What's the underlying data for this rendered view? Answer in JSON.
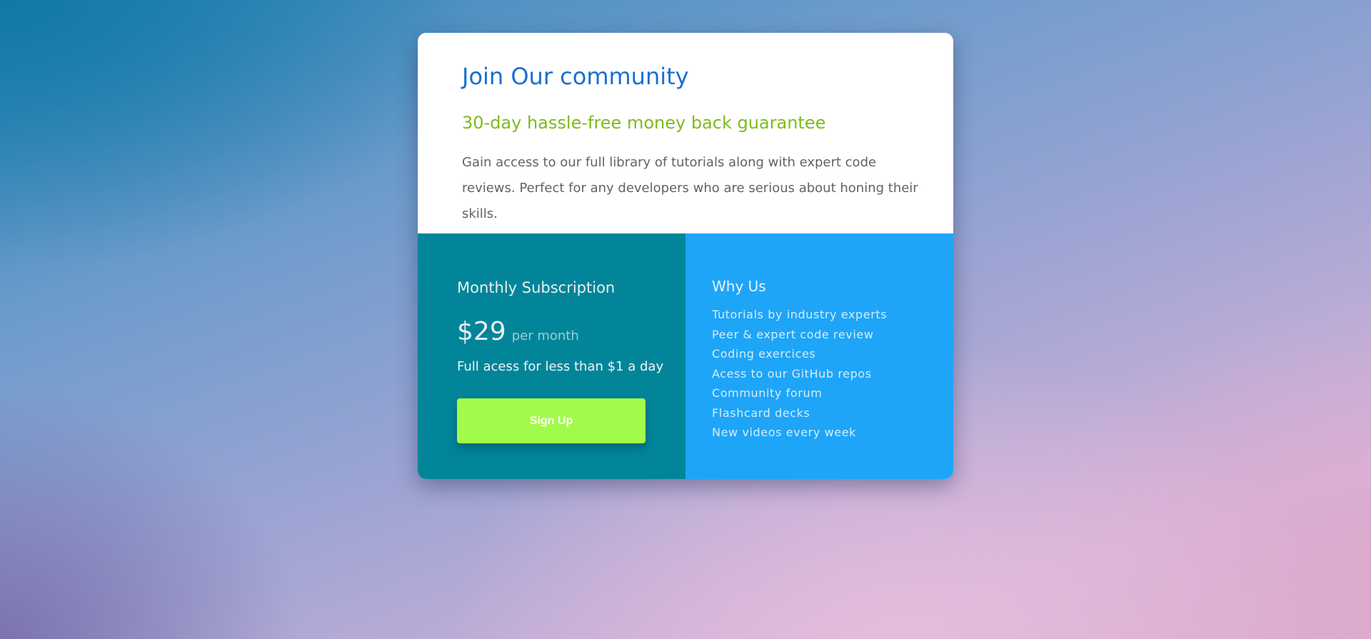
{
  "card": {
    "title": "Join Our community",
    "guarantee": "30-day hassle-free money back guarantee",
    "description": "Gain access to our full library of tutorials along with expert code reviews. Perfect for any developers who are serious about honing their skills."
  },
  "subscription": {
    "title": "Monthly Subscription",
    "price": "$29",
    "price_unit": "per month",
    "access_note": "Full acess for less than $1 a day",
    "signup_label": "Sign Up"
  },
  "why_us": {
    "title": "Why Us",
    "items": [
      "Tutorials by industry experts",
      "Peer & expert code review",
      "Coding exercices",
      "Acess to our GitHub repos",
      "Community forum",
      "Flashcard decks",
      "New videos every week"
    ]
  },
  "colors": {
    "title_blue": "#1a6fd0",
    "guarantee_green": "#7dbb1c",
    "subscription_teal": "#028599",
    "why_us_blue": "#1ea5f8",
    "signup_lime": "#a2fb4a"
  }
}
